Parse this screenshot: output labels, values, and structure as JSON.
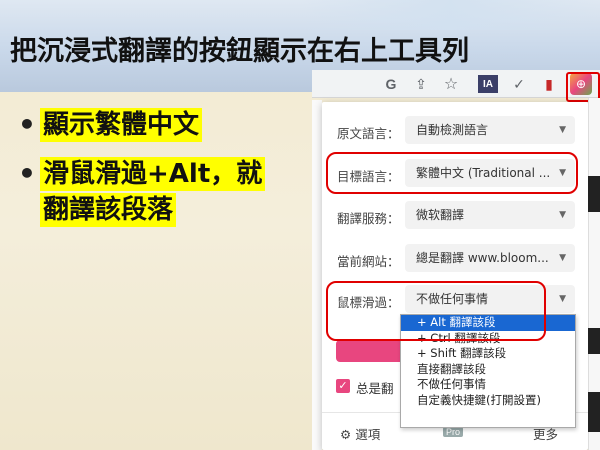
{
  "slide": {
    "title": "把沉浸式翻譯的按鈕顯示在右上工具列",
    "bullets": [
      {
        "marker": "•",
        "lines": [
          "顯示繁體中文"
        ]
      },
      {
        "marker": "•",
        "lines": [
          "滑鼠滑過+Alt，就",
          "翻譯該段落"
        ]
      }
    ]
  },
  "toolbar": {
    "icons": [
      {
        "name": "google-icon",
        "glyph": "G",
        "color": "#4285f4"
      },
      {
        "name": "share-icon",
        "glyph": "⇪",
        "color": "#5f6368"
      },
      {
        "name": "star-icon",
        "glyph": "☆",
        "color": "#5f6368"
      },
      {
        "name": "instapaper-icon",
        "glyph": "IA",
        "color": "#ffffff"
      },
      {
        "name": "checkmark-icon",
        "glyph": "✓",
        "color": "#5f6368"
      },
      {
        "name": "bookmark-ext-icon",
        "glyph": "▮",
        "color": "#c62828"
      },
      {
        "name": "immersive-translate-icon",
        "glyph": "⊕",
        "color": "#e8467f"
      }
    ]
  },
  "popup": {
    "source_language": {
      "label": "原文語言：",
      "value": "自動檢測語言"
    },
    "target_language": {
      "label": "目標語言：",
      "value": "繁體中文 (Traditional ..."
    },
    "translation_service": {
      "label": "翻譯服務：",
      "value": "微软翻譯"
    },
    "current_site": {
      "label": "當前網站：",
      "value": "總是翻譯 www.bloom..."
    },
    "mouse_hover": {
      "label": "鼠標滑過：",
      "value": "不做任何事情"
    },
    "always_translate_label": "总是翻",
    "footer": {
      "settings": "選項",
      "pro_badge": "Pro",
      "more": "更多"
    }
  },
  "dropdown": {
    "options": [
      {
        "label": "+ Alt 翻譯該段",
        "selected": true
      },
      {
        "label": "+ Ctrl 翻譯該段",
        "selected": false
      },
      {
        "label": "+ Shift 翻譯該段",
        "selected": false
      },
      {
        "label": "直接翻譯該段",
        "selected": false
      },
      {
        "label": "不做任何事情",
        "selected": false
      },
      {
        "label": "自定義快捷鍵(打開設置)",
        "selected": false
      }
    ]
  },
  "colors": {
    "highlight": "#ffff00",
    "annotation_red": "#e00000",
    "accent_pink": "#e8467f",
    "selected_blue": "#1967d2"
  }
}
